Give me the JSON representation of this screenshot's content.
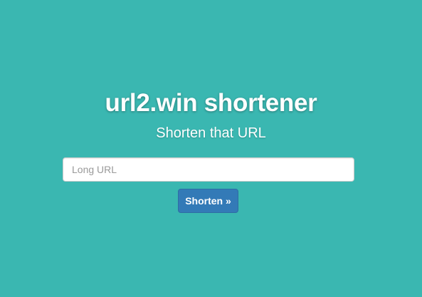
{
  "header": {
    "title": "url2.win shortener",
    "subtitle": "Shorten that URL"
  },
  "form": {
    "url_input": {
      "value": "",
      "placeholder": "Long URL"
    },
    "submit_label": "Shorten »"
  },
  "colors": {
    "background": "#3ab7b1",
    "primary_button": "#337ab7",
    "text": "#ffffff"
  }
}
